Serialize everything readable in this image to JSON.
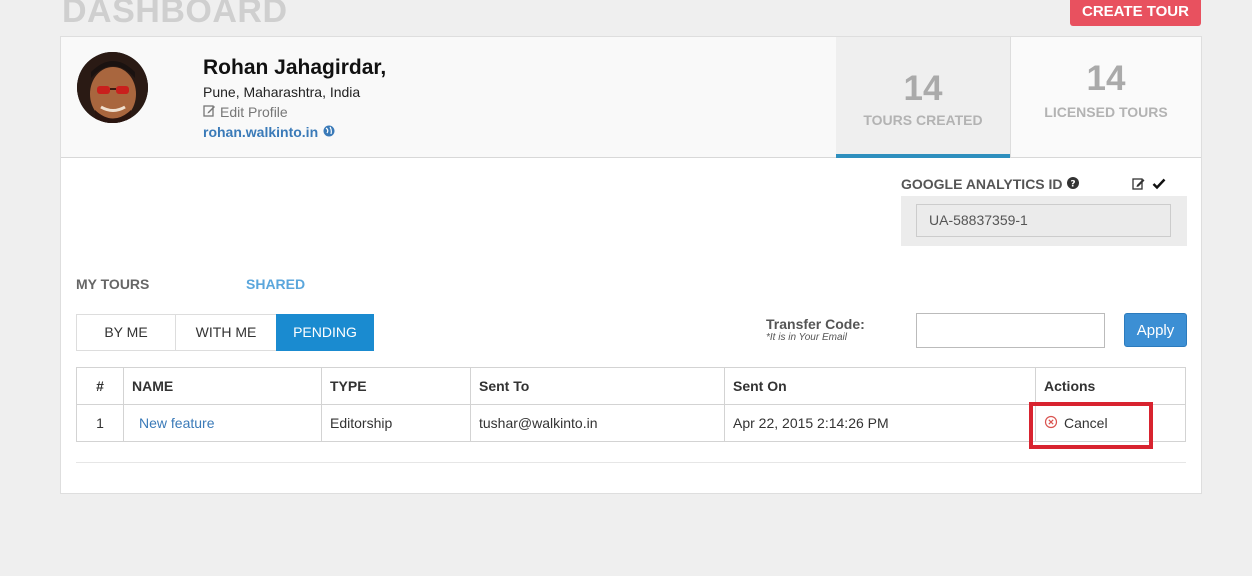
{
  "page": {
    "title": "DASHBOARD",
    "create_button": "CREATE TOUR"
  },
  "profile": {
    "name": "Rohan Jahagirdar,",
    "location": "Pune, Maharashtra, India",
    "edit_label": "Edit Profile",
    "website": "rohan.walkinto.in"
  },
  "stats": [
    {
      "value": "14",
      "label": "TOURS CREATED"
    },
    {
      "value": "14",
      "label": "LICENSED TOURS"
    }
  ],
  "analytics": {
    "label": "GOOGLE ANALYTICS ID",
    "value": "UA-58837359-1"
  },
  "tour_tabs": {
    "my": "MY TOURS",
    "shared": "SHARED"
  },
  "segments": [
    "BY ME",
    "WITH ME",
    "PENDING"
  ],
  "transfer": {
    "label": "Transfer Code:",
    "note": "*It is in Your Email",
    "apply": "Apply"
  },
  "table": {
    "headers": [
      "#",
      "NAME",
      "TYPE",
      "Sent To",
      "Sent On",
      "Actions"
    ],
    "rows": [
      {
        "num": "1",
        "name": "New feature",
        "type": "Editorship",
        "sent_to": "tushar@walkinto.in",
        "sent_on": "Apr 22, 2015 2:14:26 PM",
        "action": "Cancel"
      }
    ]
  },
  "colors": {
    "accent": "#1a8bd0",
    "create": "#e8515f",
    "highlight": "#d8232f",
    "link": "#3a7ab8"
  }
}
